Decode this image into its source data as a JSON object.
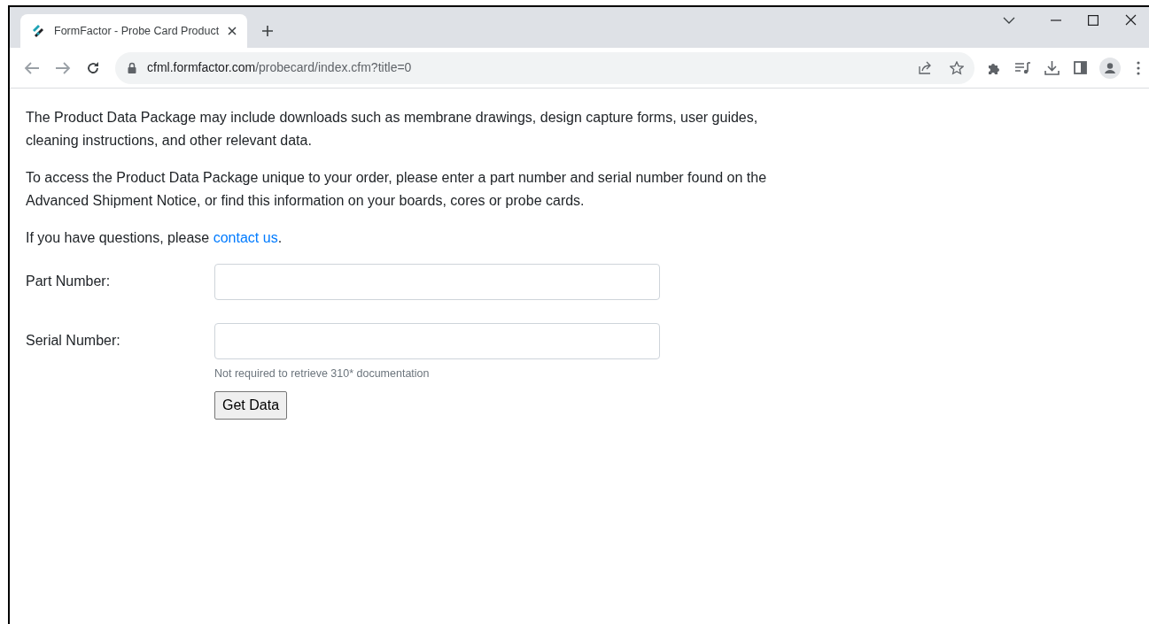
{
  "browser": {
    "tabs": [
      {
        "title": "FormFactor - Probe Card Product",
        "selected": true
      }
    ],
    "url": {
      "host": "cfml.formfactor.com",
      "path": "/probecard/index.cfm?title=0"
    }
  },
  "paragraphs": [
    {
      "text": "The Product Data Package may include downloads such as membrane drawings, design capture forms, user guides, cleaning instructions, and other relevant data."
    },
    {
      "text": "To access the Product Data Package unique to your order, please enter a part number and serial number found on the Advanced Shipment Notice, or find this information on your boards, cores or probe cards."
    },
    {
      "text": "If you have questions, please ",
      "link": "contact us",
      "after": "."
    }
  ],
  "form": {
    "fields": [
      {
        "label": "Part Number:"
      },
      {
        "label": "Serial Number:",
        "hint": "Not required to retrieve 310* documentation"
      }
    ],
    "submit": "Get Data"
  }
}
